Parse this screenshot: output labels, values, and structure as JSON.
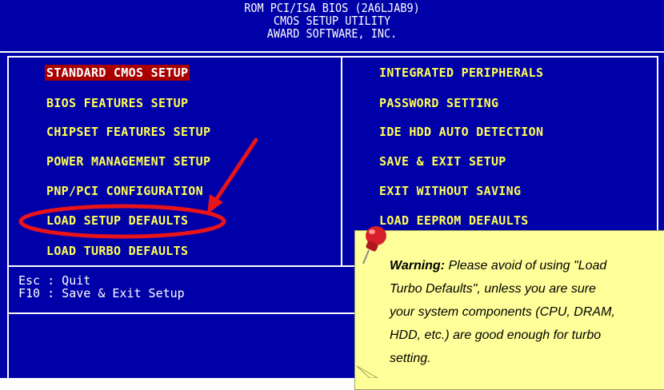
{
  "header": {
    "line1": "ROM PCI/ISA BIOS (2A6LJAB9)",
    "line2": "CMOS SETUP UTILITY",
    "line3": "AWARD SOFTWARE, INC."
  },
  "menu_left": [
    {
      "label": "STANDARD CMOS SETUP",
      "selected": true
    },
    {
      "label": "BIOS FEATURES SETUP"
    },
    {
      "label": "CHIPSET FEATURES SETUP"
    },
    {
      "label": "POWER MANAGEMENT SETUP"
    },
    {
      "label": "PNP/PCI CONFIGURATION"
    },
    {
      "label": "LOAD SETUP DEFAULTS",
      "highlighted": true
    },
    {
      "label": "LOAD TURBO DEFAULTS"
    }
  ],
  "menu_right": [
    {
      "label": "INTEGRATED PERIPHERALS"
    },
    {
      "label": "PASSWORD SETTING"
    },
    {
      "label": "IDE HDD AUTO DETECTION"
    },
    {
      "label": "SAVE & EXIT SETUP"
    },
    {
      "label": "EXIT WITHOUT SAVING"
    },
    {
      "label": "LOAD EEPROM DEFAULTS"
    }
  ],
  "help": {
    "line1": "Esc : Quit",
    "line2": "F10 : Save & Exit Setup"
  },
  "note": {
    "warning_label": "Warning:",
    "line1_rest": " Please avoid of using \"Load",
    "line2": "Turbo Defaults\", unless you are sure",
    "line3": "your system components (CPU, DRAM,",
    "line4": "HDD, etc.) are good enough for turbo",
    "line5": "setting."
  },
  "colors": {
    "bios_bg": "#0000a8",
    "menu_text": "#ffff54",
    "selected_bg": "#a80000",
    "annotation_red": "#e8141a",
    "note_bg": "#ffff99"
  },
  "icons": [
    "pushpin-icon",
    "arrow-annotation",
    "ellipse-annotation"
  ]
}
